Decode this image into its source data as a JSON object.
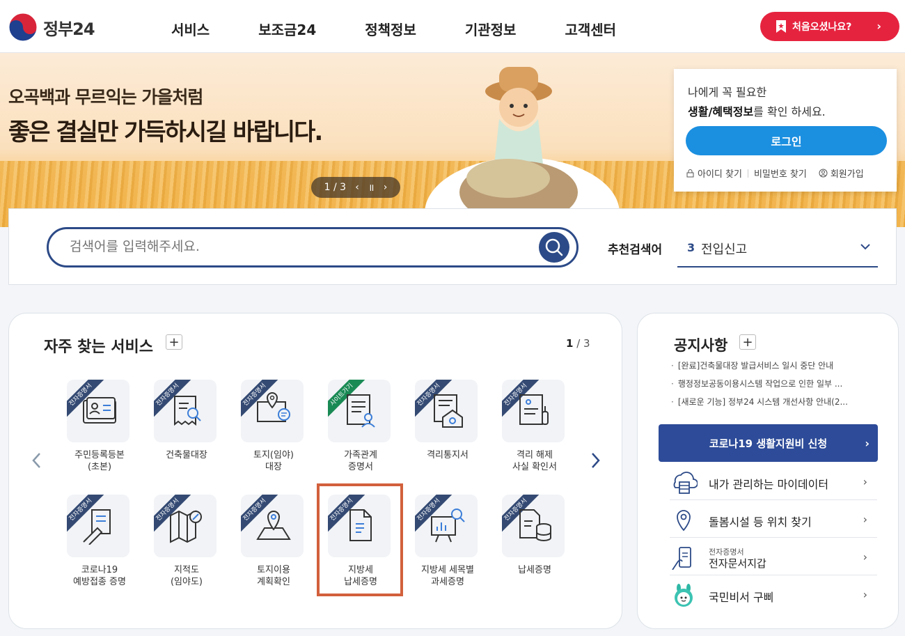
{
  "header": {
    "logo_text": "정부24",
    "nav": [
      "서비스",
      "보조금24",
      "정책정보",
      "기관정보",
      "고객센터"
    ],
    "first_visit_label": "처음오셨나요?"
  },
  "banner": {
    "line1": "오곡백과 무르익는 가을처럼",
    "line2": "좋은 결실만 가득하시길 바랍니다.",
    "slide_indicator": "1 / 3"
  },
  "login_card": {
    "line1": "나에게 꼭 필요한",
    "line2_bold": "생활/혜택정보",
    "line2_rest": "를 확인 하세요.",
    "login_label": "로그인",
    "find_id": "아이디 찾기",
    "find_pw": "비밀번호 찾기",
    "signup": "회원가입"
  },
  "search": {
    "placeholder": "검색어를 입력해주세요.",
    "rec_label": "추천검색어",
    "rec_num": "3",
    "rec_text": "전입신고"
  },
  "services": {
    "title": "자주 찾는 서비스",
    "pager_current": "1",
    "pager_total": " / 3",
    "items": [
      {
        "tag": "전자증명서",
        "label": "주민등록등본\n(초본)",
        "icon": "id-card-icon"
      },
      {
        "tag": "전자증명서",
        "label": "건축물대장",
        "icon": "building-register-icon"
      },
      {
        "tag": "전자증명서",
        "label": "토지(임야)\n대장",
        "icon": "land-location-icon"
      },
      {
        "tag": "사이트가기",
        "label": "가족관계\n증명서",
        "icon": "family-document-icon"
      },
      {
        "tag": "전자증명서",
        "label": "격리통지서",
        "icon": "quarantine-notice-icon"
      },
      {
        "tag": "전자증명서",
        "label": "격리 해제\n사실 확인서",
        "icon": "quarantine-release-icon"
      },
      {
        "tag": "전자증명서",
        "label": "코로나19\n예방접종 증명",
        "icon": "vaccine-icon"
      },
      {
        "tag": "전자증명서",
        "label": "지적도\n(임야도)",
        "icon": "cadastral-map-icon"
      },
      {
        "tag": "전자증명서",
        "label": "토지이용\n계획확인",
        "icon": "land-use-icon"
      },
      {
        "tag": "전자증명서",
        "label": "지방세\n납세증명",
        "icon": "local-tax-icon"
      },
      {
        "tag": "전자증명서",
        "label": "지방세 세목별\n과세증명",
        "icon": "tax-chart-icon"
      },
      {
        "tag": "전자증명서",
        "label": "납세증명",
        "icon": "tax-payment-icon"
      }
    ]
  },
  "notice": {
    "title": "공지사항",
    "items": [
      "[완료]건축물대장 발급서비스 일시 중단 안내",
      "행정정보공동이용시스템 작업으로 인한 일부 ...",
      "[새로운 기능] 정부24 시스템 개선사항 안내(2..."
    ],
    "covid_label": "코로나19 생활지원비 신청",
    "links": {
      "mydata": "내가 관리하는 마이데이터",
      "care": "돌봄시설 등 위치 찾기",
      "wallet_small": "전자증명서",
      "wallet": "전자문서지갑",
      "gubbi": "국민비서 구삐"
    }
  },
  "colors": {
    "brand_navy": "#2c4a87",
    "accent_red": "#e6233f",
    "login_blue": "#1b8fe0",
    "highlight_orange": "#d2603c"
  }
}
